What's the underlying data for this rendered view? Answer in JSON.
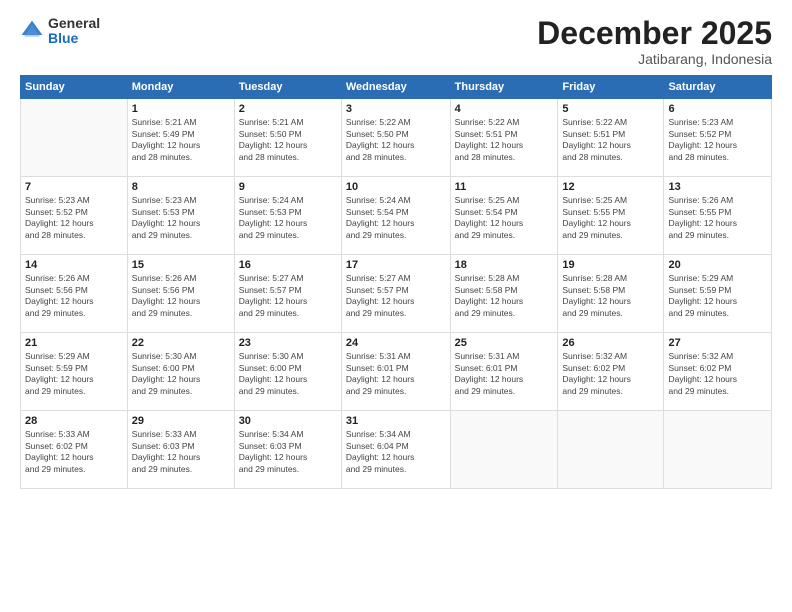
{
  "logo": {
    "general": "General",
    "blue": "Blue"
  },
  "header": {
    "month": "December 2025",
    "location": "Jatibarang, Indonesia"
  },
  "weekdays": [
    "Sunday",
    "Monday",
    "Tuesday",
    "Wednesday",
    "Thursday",
    "Friday",
    "Saturday"
  ],
  "weeks": [
    [
      {
        "day": "",
        "info": ""
      },
      {
        "day": "1",
        "info": "Sunrise: 5:21 AM\nSunset: 5:49 PM\nDaylight: 12 hours\nand 28 minutes."
      },
      {
        "day": "2",
        "info": "Sunrise: 5:21 AM\nSunset: 5:50 PM\nDaylight: 12 hours\nand 28 minutes."
      },
      {
        "day": "3",
        "info": "Sunrise: 5:22 AM\nSunset: 5:50 PM\nDaylight: 12 hours\nand 28 minutes."
      },
      {
        "day": "4",
        "info": "Sunrise: 5:22 AM\nSunset: 5:51 PM\nDaylight: 12 hours\nand 28 minutes."
      },
      {
        "day": "5",
        "info": "Sunrise: 5:22 AM\nSunset: 5:51 PM\nDaylight: 12 hours\nand 28 minutes."
      },
      {
        "day": "6",
        "info": "Sunrise: 5:23 AM\nSunset: 5:52 PM\nDaylight: 12 hours\nand 28 minutes."
      }
    ],
    [
      {
        "day": "7",
        "info": "Sunrise: 5:23 AM\nSunset: 5:52 PM\nDaylight: 12 hours\nand 28 minutes."
      },
      {
        "day": "8",
        "info": "Sunrise: 5:23 AM\nSunset: 5:53 PM\nDaylight: 12 hours\nand 29 minutes."
      },
      {
        "day": "9",
        "info": "Sunrise: 5:24 AM\nSunset: 5:53 PM\nDaylight: 12 hours\nand 29 minutes."
      },
      {
        "day": "10",
        "info": "Sunrise: 5:24 AM\nSunset: 5:54 PM\nDaylight: 12 hours\nand 29 minutes."
      },
      {
        "day": "11",
        "info": "Sunrise: 5:25 AM\nSunset: 5:54 PM\nDaylight: 12 hours\nand 29 minutes."
      },
      {
        "day": "12",
        "info": "Sunrise: 5:25 AM\nSunset: 5:55 PM\nDaylight: 12 hours\nand 29 minutes."
      },
      {
        "day": "13",
        "info": "Sunrise: 5:26 AM\nSunset: 5:55 PM\nDaylight: 12 hours\nand 29 minutes."
      }
    ],
    [
      {
        "day": "14",
        "info": "Sunrise: 5:26 AM\nSunset: 5:56 PM\nDaylight: 12 hours\nand 29 minutes."
      },
      {
        "day": "15",
        "info": "Sunrise: 5:26 AM\nSunset: 5:56 PM\nDaylight: 12 hours\nand 29 minutes."
      },
      {
        "day": "16",
        "info": "Sunrise: 5:27 AM\nSunset: 5:57 PM\nDaylight: 12 hours\nand 29 minutes."
      },
      {
        "day": "17",
        "info": "Sunrise: 5:27 AM\nSunset: 5:57 PM\nDaylight: 12 hours\nand 29 minutes."
      },
      {
        "day": "18",
        "info": "Sunrise: 5:28 AM\nSunset: 5:58 PM\nDaylight: 12 hours\nand 29 minutes."
      },
      {
        "day": "19",
        "info": "Sunrise: 5:28 AM\nSunset: 5:58 PM\nDaylight: 12 hours\nand 29 minutes."
      },
      {
        "day": "20",
        "info": "Sunrise: 5:29 AM\nSunset: 5:59 PM\nDaylight: 12 hours\nand 29 minutes."
      }
    ],
    [
      {
        "day": "21",
        "info": "Sunrise: 5:29 AM\nSunset: 5:59 PM\nDaylight: 12 hours\nand 29 minutes."
      },
      {
        "day": "22",
        "info": "Sunrise: 5:30 AM\nSunset: 6:00 PM\nDaylight: 12 hours\nand 29 minutes."
      },
      {
        "day": "23",
        "info": "Sunrise: 5:30 AM\nSunset: 6:00 PM\nDaylight: 12 hours\nand 29 minutes."
      },
      {
        "day": "24",
        "info": "Sunrise: 5:31 AM\nSunset: 6:01 PM\nDaylight: 12 hours\nand 29 minutes."
      },
      {
        "day": "25",
        "info": "Sunrise: 5:31 AM\nSunset: 6:01 PM\nDaylight: 12 hours\nand 29 minutes."
      },
      {
        "day": "26",
        "info": "Sunrise: 5:32 AM\nSunset: 6:02 PM\nDaylight: 12 hours\nand 29 minutes."
      },
      {
        "day": "27",
        "info": "Sunrise: 5:32 AM\nSunset: 6:02 PM\nDaylight: 12 hours\nand 29 minutes."
      }
    ],
    [
      {
        "day": "28",
        "info": "Sunrise: 5:33 AM\nSunset: 6:02 PM\nDaylight: 12 hours\nand 29 minutes."
      },
      {
        "day": "29",
        "info": "Sunrise: 5:33 AM\nSunset: 6:03 PM\nDaylight: 12 hours\nand 29 minutes."
      },
      {
        "day": "30",
        "info": "Sunrise: 5:34 AM\nSunset: 6:03 PM\nDaylight: 12 hours\nand 29 minutes."
      },
      {
        "day": "31",
        "info": "Sunrise: 5:34 AM\nSunset: 6:04 PM\nDaylight: 12 hours\nand 29 minutes."
      },
      {
        "day": "",
        "info": ""
      },
      {
        "day": "",
        "info": ""
      },
      {
        "day": "",
        "info": ""
      }
    ]
  ]
}
